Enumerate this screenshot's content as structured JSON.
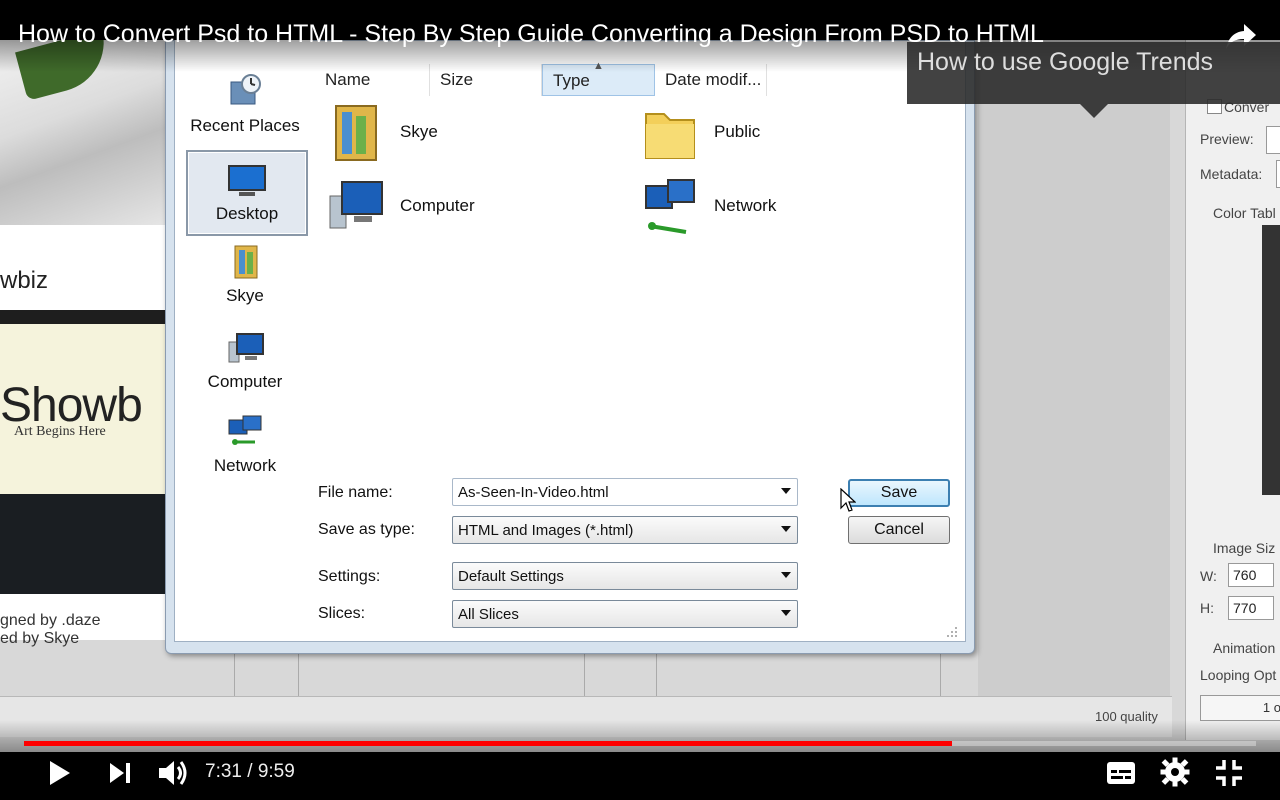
{
  "player": {
    "title": "How to Convert Psd to HTML - Step By Step Guide Converting a Design From PSD to HTML",
    "tooltip": "How to use Google Trends",
    "time_display": "7:31 / 9:59",
    "progress": 0.753,
    "accent_color": "#ff0000",
    "icons": [
      "share-icon",
      "play-icon",
      "next-icon",
      "volume-icon",
      "captions-icon",
      "settings-gear-icon",
      "exit-fullscreen-icon"
    ]
  },
  "dialog": {
    "nav_pane": {
      "items": [
        {
          "label": "Recent Places",
          "icon": "recent-places-icon"
        },
        {
          "label": "Desktop",
          "icon": "desktop-icon",
          "selected": true
        },
        {
          "label": "Skye",
          "icon": "user-folder-icon"
        },
        {
          "label": "Computer",
          "icon": "computer-icon"
        },
        {
          "label": "Network",
          "icon": "network-icon"
        }
      ]
    },
    "columns": {
      "name": "Name",
      "size": "Size",
      "type": "Type",
      "date": "Date modif..."
    },
    "files": {
      "skye": "Skye",
      "public": "Public",
      "computer": "Computer",
      "network": "Network"
    },
    "form": {
      "file_name_label": "File name:",
      "file_name_value": "As-Seen-In-Video.html",
      "save_type_label": "Save as type:",
      "save_type_value": "HTML and Images (*.html)",
      "settings_label": "Settings:",
      "settings_value": "Default Settings",
      "slices_label": "Slices:",
      "slices_value": "All Slices"
    },
    "buttons": {
      "save": "Save",
      "cancel": "Cancel"
    }
  },
  "background_page": {
    "nav_text": "wbiz",
    "logo_text": "Showb",
    "logo_sub": "Art Begins Here",
    "credit_line1": "gned by .daze",
    "credit_line2": "ed by Skye"
  },
  "photoshop_panel": {
    "convert": "Conver",
    "preview": "Preview:",
    "metadata": "Metadata:",
    "color_table": "Color Tabl",
    "image_size": "Image Siz",
    "w_label": "W:",
    "w_value": "760",
    "h_label": "H:",
    "h_value": "770",
    "animation": "Animation",
    "looping": "Looping Opt",
    "loop_button": "1 o",
    "quality": "100 quality"
  }
}
